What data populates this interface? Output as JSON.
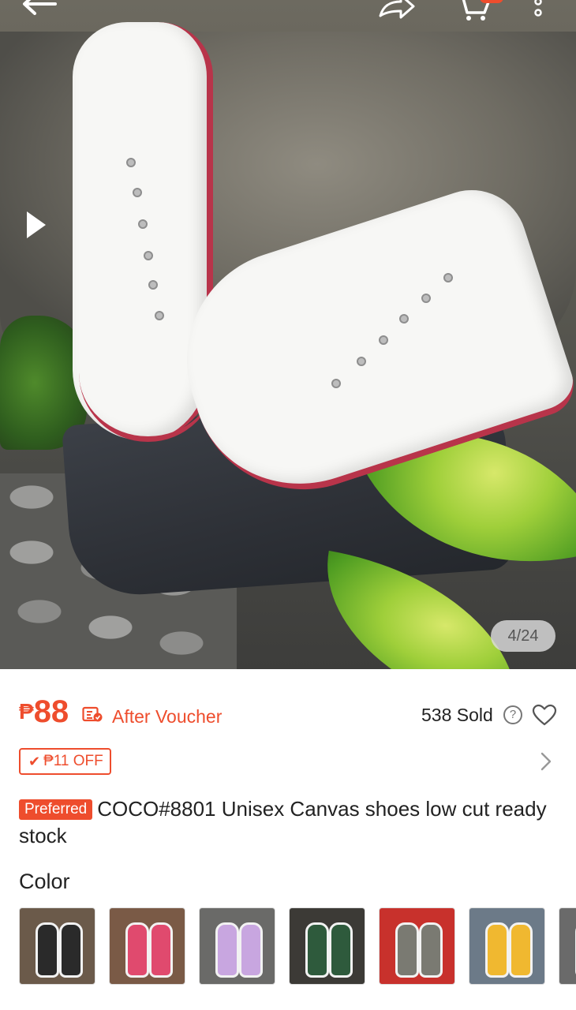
{
  "gallery": {
    "counter": "4/24"
  },
  "product": {
    "currency": "₱",
    "price": "88",
    "after_voucher_label": "After Voucher",
    "sold_label": "538 Sold",
    "discount_label": "₱11 OFF",
    "preferred_badge": "Preferred",
    "title": "COCO#8801 Unisex Canvas shoes low cut ready stock"
  },
  "variations": {
    "label": "Color",
    "swatches": [
      {
        "name": "black",
        "bg": "#6b5a4a",
        "shoe": "#2a2a2a"
      },
      {
        "name": "pink",
        "bg": "#7a5a46",
        "shoe": "#e04a6e"
      },
      {
        "name": "lavender",
        "bg": "#6a6a68",
        "shoe": "#c8a6e0"
      },
      {
        "name": "green",
        "bg": "#3c3a36",
        "shoe": "#2e5a3c"
      },
      {
        "name": "gray",
        "bg": "#c8312c",
        "shoe": "#7a7a72"
      },
      {
        "name": "yellow",
        "bg": "#6c7a88",
        "shoe": "#f0b830"
      },
      {
        "name": "partial",
        "bg": "#6a6a6a",
        "shoe": "#8a8a8a"
      }
    ]
  },
  "colors": {
    "accent": "#ee4d2d"
  }
}
